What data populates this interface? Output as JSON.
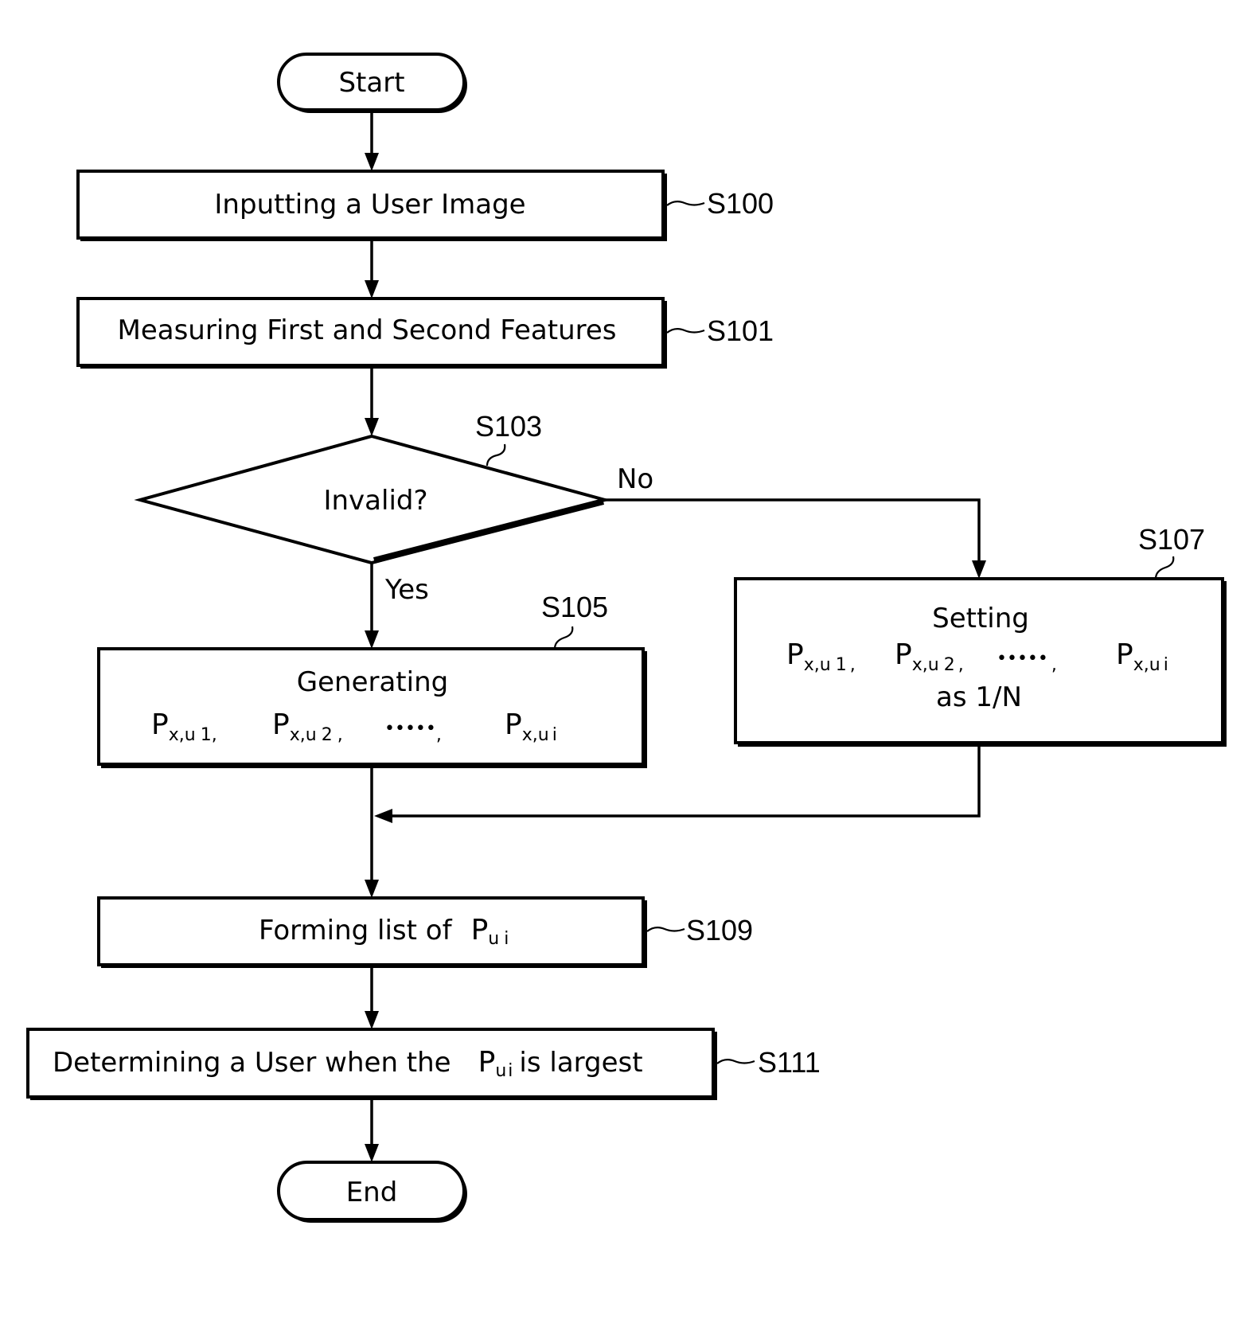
{
  "colors": {
    "ink": "#000000",
    "paper": "#ffffff"
  },
  "nodes": {
    "start": {
      "label": "Start"
    },
    "s100": {
      "label": "Inputting a User Image",
      "step": "S100"
    },
    "s101": {
      "label": "Measuring First and Second Features",
      "step": "S101"
    },
    "s103": {
      "label": "Invalid?",
      "step": "S103",
      "yes_label": "Yes",
      "no_label": "No"
    },
    "s105": {
      "label": "Generating",
      "step": "S105",
      "terms": [
        {
          "base": "P",
          "sub": "x,u",
          "index": "1",
          "sep": ","
        },
        {
          "base": "P",
          "sub": "x,u",
          "index": "2",
          "sep": ","
        },
        {
          "ellipsis": "•••••",
          "sep": ","
        },
        {
          "base": "P",
          "sub": "x,u",
          "index": "i",
          "sep": ""
        }
      ]
    },
    "s107": {
      "label": "Setting",
      "step": "S107",
      "suffix": "as 1/N",
      "terms": [
        {
          "base": "P",
          "sub": "x,u",
          "index": "1",
          "sep": ","
        },
        {
          "base": "P",
          "sub": "x,u",
          "index": "2",
          "sep": ","
        },
        {
          "ellipsis": "•••••",
          "sep": ","
        },
        {
          "base": "P",
          "sub": "x,u",
          "index": "i",
          "sep": ""
        }
      ]
    },
    "s109": {
      "label_prefix": "Forming list of",
      "var_base": "P",
      "var_sub": "u",
      "var_index": "i",
      "step": "S109"
    },
    "s111": {
      "label_prefix": "Determining a User when the",
      "var_base": "P",
      "var_sub": "u",
      "var_index": "i",
      "label_suffix": "is largest",
      "step": "S111"
    },
    "end": {
      "label": "End"
    }
  }
}
